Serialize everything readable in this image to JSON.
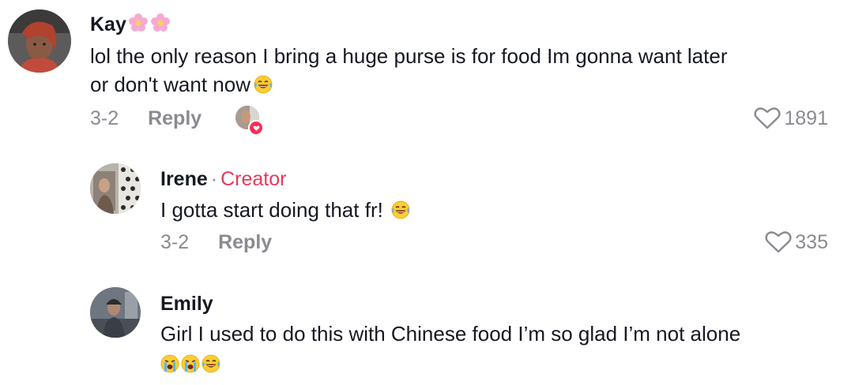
{
  "comments": [
    {
      "username": "Kay",
      "username_emoji": [
        "pink-flower-icon",
        "pink-flower-icon"
      ],
      "text_line1": "lol the only reason I bring a huge purse is for food Im gonna want later",
      "text_line2": "or don't want now",
      "text_emoji": [
        "laugh-cry-emoji"
      ],
      "date": "3-2",
      "reply_label": "Reply",
      "liked_by_creator": true,
      "likes": "1891"
    },
    {
      "username": "Irene",
      "separator": "·",
      "badge": "Creator",
      "text_line1": "I gotta start doing that fr!",
      "text_emoji": [
        "laugh-cry-emoji"
      ],
      "date": "3-2",
      "reply_label": "Reply",
      "likes": "335"
    },
    {
      "username": "Emily",
      "text_line1": "Girl I used to do this with Chinese food I’m so glad I’m not alone",
      "text_emoji": [
        "loudly-crying-emoji",
        "loudly-crying-emoji",
        "laugh-cry-emoji"
      ]
    }
  ],
  "colors": {
    "text": "#161823",
    "secondary": "#8a8b91",
    "creator": "#e8385a",
    "like_badge": "#fe2c55"
  }
}
